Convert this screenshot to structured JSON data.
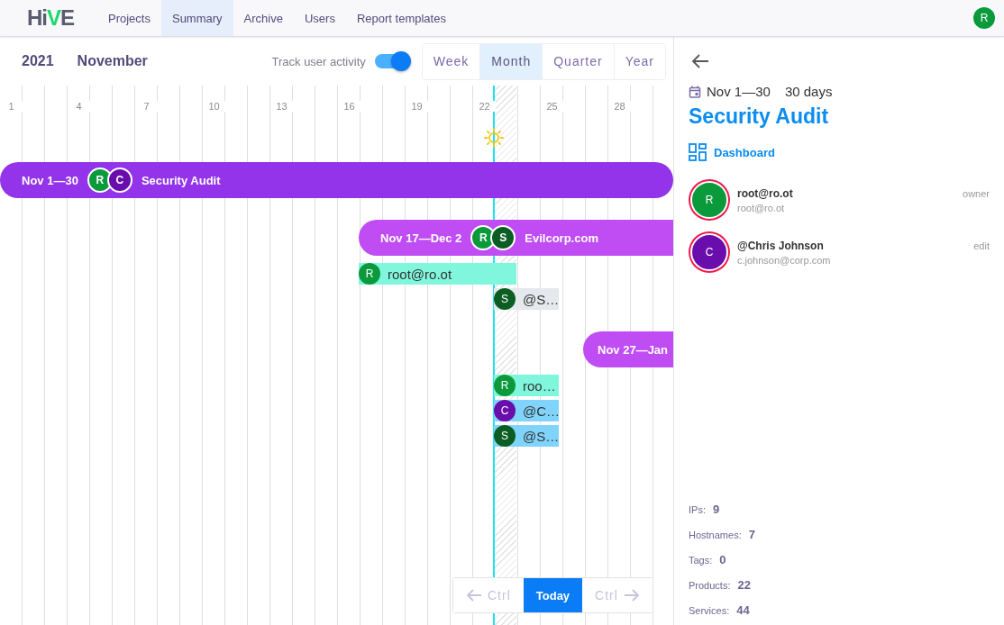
{
  "header": {
    "logo": "HiVE",
    "tabs": [
      {
        "label": "Projects",
        "selected": false
      },
      {
        "label": "Summary",
        "selected": true
      },
      {
        "label": "Archive",
        "selected": false
      },
      {
        "label": "Users",
        "selected": false
      },
      {
        "label": "Report templates",
        "selected": false
      }
    ],
    "user_avatar": {
      "initial": "R",
      "color": "#0a9a3c"
    }
  },
  "toolbar": {
    "year": "2021",
    "month": "November",
    "track_label": "Track user activity",
    "track_on": true,
    "periods": [
      {
        "label": "Week",
        "selected": false
      },
      {
        "label": "Month",
        "selected": true
      },
      {
        "label": "Quarter",
        "selected": false
      },
      {
        "label": "Year",
        "selected": false
      }
    ]
  },
  "day_labels": [
    "1",
    "4",
    "7",
    "10",
    "13",
    "16",
    "19",
    "22",
    "25",
    "28"
  ],
  "projects": [
    {
      "dates": "Nov 1—30",
      "name": "Security Audit",
      "color": "#9333ea",
      "avatars": [
        {
          "initial": "R",
          "color": "#0a9a3c"
        },
        {
          "initial": "C",
          "color": "#6a0dad"
        }
      ]
    },
    {
      "dates": "Nov 17—Dec 2",
      "name": "Evilcorp.com",
      "color": "#c04cf4",
      "avatars": [
        {
          "initial": "R",
          "color": "#0a9a3c"
        },
        {
          "initial": "S",
          "color": "#0b5e23"
        }
      ]
    },
    {
      "dates": "Nov 27—Jan",
      "color": "#c04cf4"
    }
  ],
  "activity": [
    {
      "avatar": {
        "initial": "R",
        "color": "#0a9a3c"
      },
      "label": "root@ro.ot",
      "color": "#80f7dc"
    },
    {
      "avatar": {
        "initial": "S",
        "color": "#0b5e23"
      },
      "label": "@S…",
      "color": "#e5e8ec"
    },
    {
      "avatar": {
        "initial": "R",
        "color": "#0a9a3c"
      },
      "label": "roo…",
      "color": "#80f7dc"
    },
    {
      "avatar": {
        "initial": "C",
        "color": "#6a0dad"
      },
      "label": "@C…",
      "color": "#80d4fc"
    },
    {
      "avatar": {
        "initial": "S",
        "color": "#0b5e23"
      },
      "label": "@S…",
      "color": "#80d4fc"
    }
  ],
  "pager": {
    "prev": {
      "label": "Ctrl",
      "disabled": true
    },
    "today": "Today",
    "next": {
      "label": "Ctrl",
      "disabled": true
    }
  },
  "details": {
    "dates": "Nov 1—30",
    "duration": "30 days",
    "title": "Security Audit",
    "link": "Dashboard",
    "members": [
      {
        "initial": "R",
        "color": "#0a9a3c",
        "name": "root@ro.ot",
        "email": "root@ro.ot",
        "role": "owner"
      },
      {
        "initial": "C",
        "color": "#6a0dad",
        "name": "@Chris Johnson",
        "email": "c.johnson@corp.com",
        "role": "edit"
      }
    ],
    "stats": [
      {
        "label": "IPs:",
        "value": "9"
      },
      {
        "label": "Hostnames:",
        "value": "7"
      },
      {
        "label": "Tags:",
        "value": "0"
      },
      {
        "label": "Products:",
        "value": "22"
      },
      {
        "label": "Services:",
        "value": "44"
      }
    ]
  }
}
